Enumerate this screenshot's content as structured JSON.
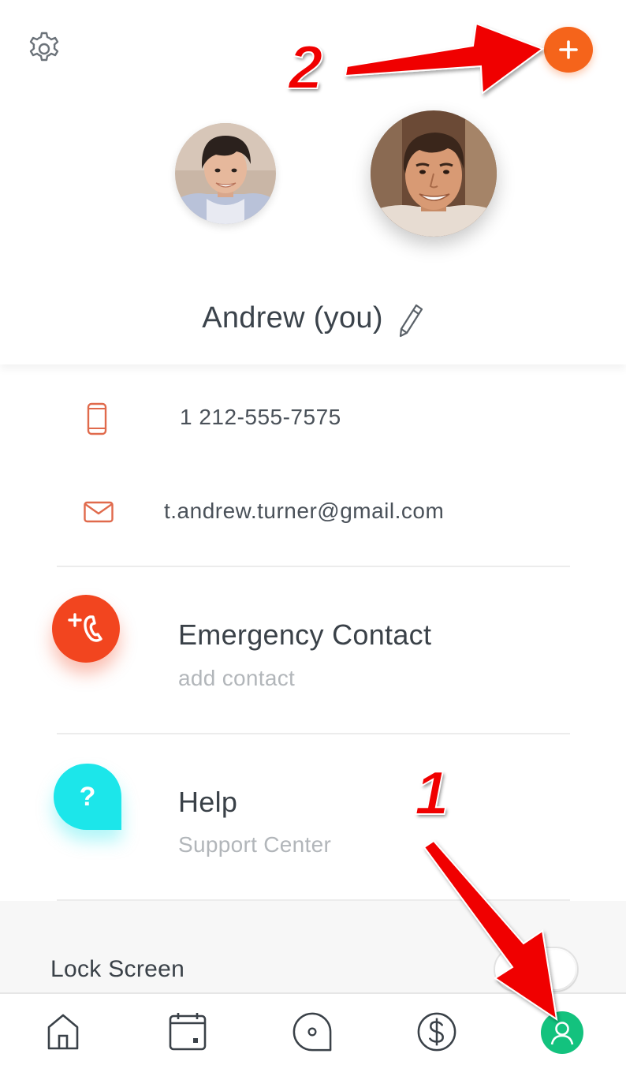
{
  "header": {
    "user_name": "Andrew (you)",
    "accent_add": "#f5641b"
  },
  "contact": {
    "phone": "1 212-555-7575",
    "email": "t.andrew.turner@gmail.com",
    "icon_color": "#e06a4c"
  },
  "rows": {
    "emergency": {
      "title": "Emergency Contact",
      "subtitle": "add contact",
      "color": "#f2451f"
    },
    "help": {
      "title": "Help",
      "subtitle": "Support Center",
      "glyph": "?",
      "color": "#1ce6ea"
    }
  },
  "settings": {
    "lock_screen_label": "Lock Screen"
  },
  "tabbar": {
    "items": [
      {
        "icon": "home-icon"
      },
      {
        "icon": "calendar-icon"
      },
      {
        "icon": "chat-bubble-icon"
      },
      {
        "icon": "dollar-icon"
      },
      {
        "icon": "profile-icon",
        "active": true,
        "color": "#13c27e"
      }
    ]
  },
  "annotations": {
    "label_1": "1",
    "label_2": "2",
    "arrow_color": "#f00000"
  }
}
